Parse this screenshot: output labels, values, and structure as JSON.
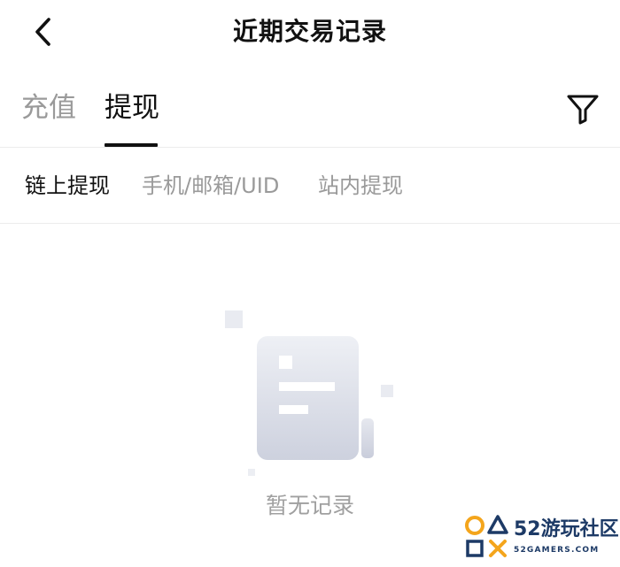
{
  "header": {
    "title": "近期交易记录",
    "back_icon": "chevron-left-icon"
  },
  "tabs": [
    {
      "label": "充值",
      "active": false
    },
    {
      "label": "提现",
      "active": true
    }
  ],
  "filter_icon": "funnel-filter-icon",
  "subtabs": [
    {
      "label": "链上提现",
      "active": true
    },
    {
      "label": "手机/邮箱/UID",
      "active": false
    },
    {
      "label": "站内提现",
      "active": false
    }
  ],
  "empty_state": {
    "icon": "empty-document-icon",
    "message": "暂无记录"
  },
  "watermark": {
    "title": "52游玩社区",
    "subtitle": "52GAMERS.COM"
  },
  "colors": {
    "text_primary": "#111111",
    "text_secondary": "#9a9a9a",
    "divider": "#ececec",
    "empty_icon": "#dde0ea",
    "watermark_accent": "#f4a51c",
    "watermark_text": "#1d3a66"
  }
}
